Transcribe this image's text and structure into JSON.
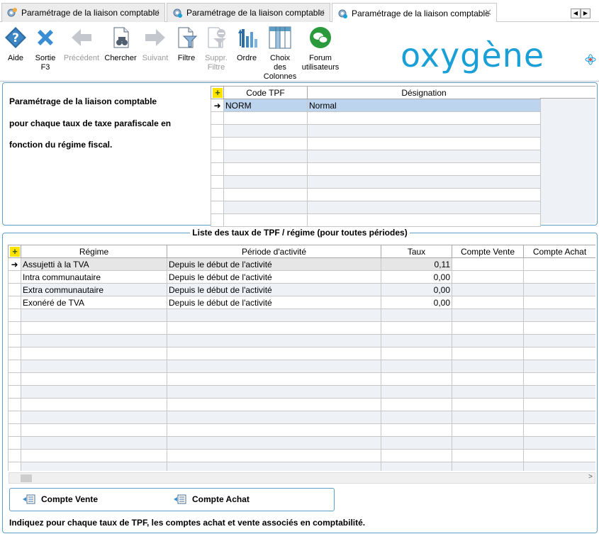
{
  "tabs": [
    {
      "label": "Paramétrage de la liaison comptable"
    },
    {
      "label": "Paramétrage de la liaison comptable"
    },
    {
      "label": "Paramétrage de la liaison comptable"
    }
  ],
  "toolbar": {
    "aide": "Aide",
    "sortie_1": "Sortie",
    "sortie_2": "F3",
    "precedent": "Précédent",
    "chercher": "Chercher",
    "suivant": "Suivant",
    "filtre": "Filtre",
    "suppr_1": "Suppr.",
    "suppr_2": "Filtre",
    "ordre": "Ordre",
    "choix_1": "Choix",
    "choix_2": "des",
    "choix_3": "Colonnes",
    "forum_1": "Forum",
    "forum_2": "utilisateurs"
  },
  "logo": {
    "text": "oxygène",
    "color": "#1aa0d6"
  },
  "top_panel": {
    "line1": "Paramétrage de la liaison comptable",
    "line2": "pour chaque taux de taxe parafiscale en",
    "line3": "fonction du régime fiscal."
  },
  "tpf_grid": {
    "headers": {
      "code": "Code TPF",
      "designation": "Désignation"
    },
    "rows": [
      {
        "code": "NORM",
        "designation": "Normal"
      }
    ]
  },
  "list": {
    "title": "Liste des taux de TPF / régime (pour toutes périodes)",
    "headers": {
      "regime": "Régime",
      "periode": "Période d'activité",
      "taux": "Taux",
      "compte_vente": "Compte Vente",
      "compte_achat": "Compte Achat"
    },
    "rows": [
      {
        "regime": "Assujetti à la TVA",
        "periode": "Depuis le début de l'activité",
        "taux": "0,11"
      },
      {
        "regime": "Intra communautaire",
        "periode": "Depuis le début de l'activité",
        "taux": "0,00"
      },
      {
        "regime": "Extra communautaire",
        "periode": "Depuis le début de l'activité",
        "taux": "0,00"
      },
      {
        "regime": "Exonéré de TVA",
        "periode": "Depuis le début de l'activité",
        "taux": "0,00"
      }
    ]
  },
  "buttons": {
    "compte_vente": "Compte Vente",
    "compte_achat": "Compte Achat"
  },
  "footer": "Indiquez pour chaque taux de TPF, les comptes achat et vente associés en comptabilité.",
  "colors": {
    "accent": "#5f9ec4",
    "selection": "#bcd4ee",
    "stripe": "#eef2f7"
  }
}
